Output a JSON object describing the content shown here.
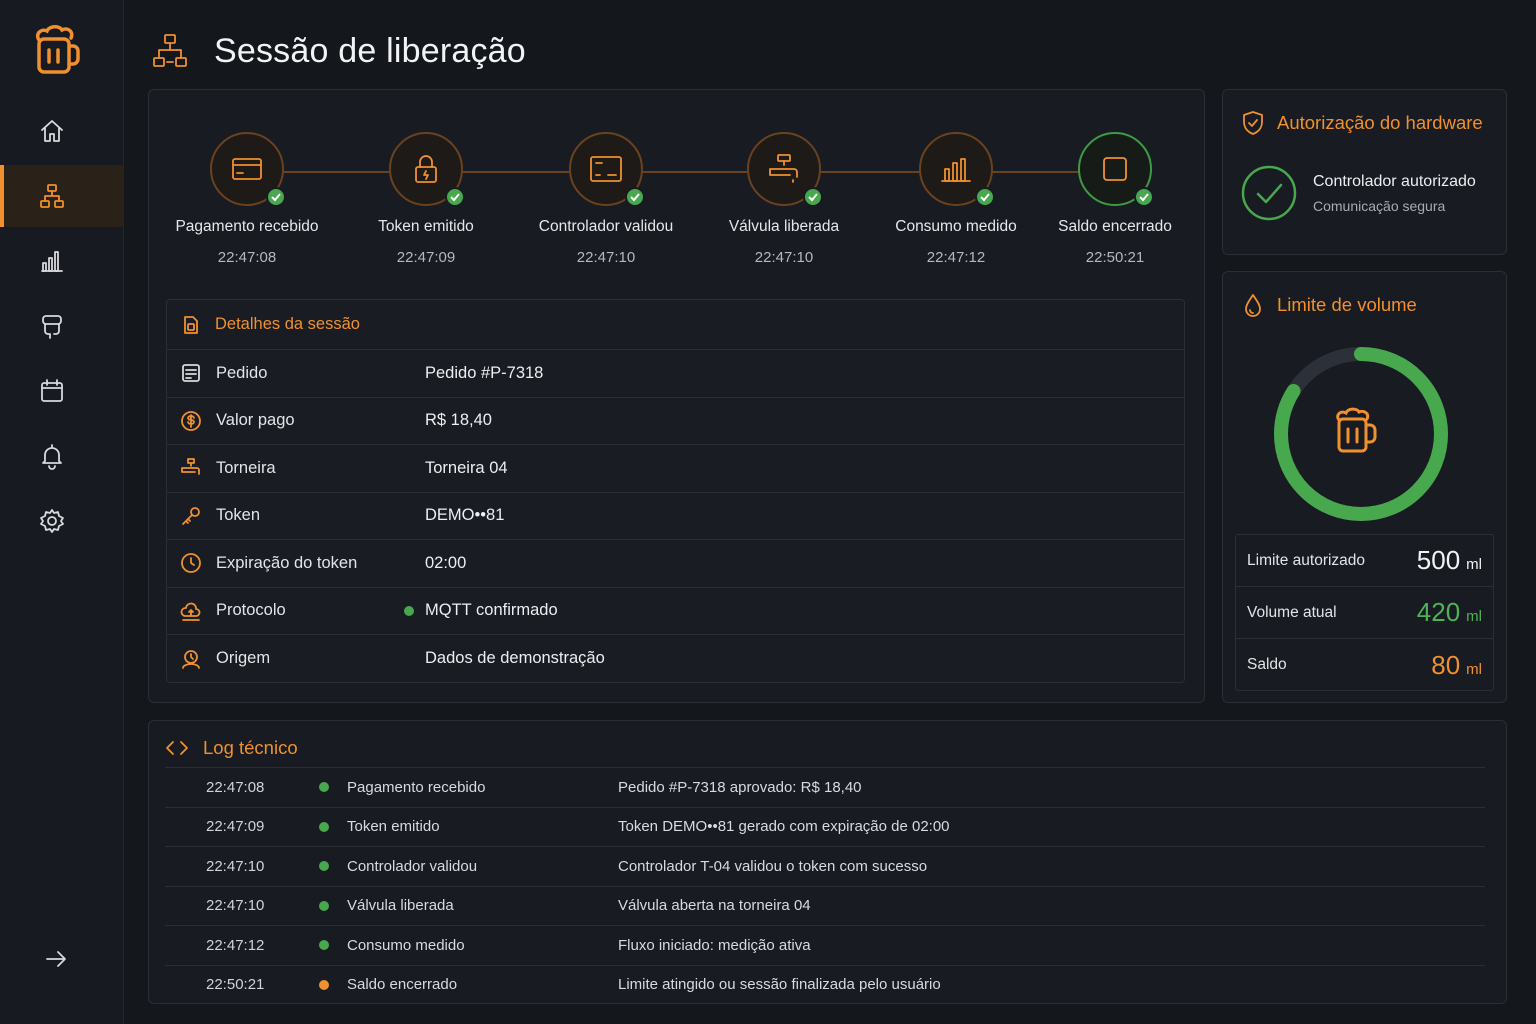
{
  "header": {
    "title": "Sessão de liberação"
  },
  "colors": {
    "accent": "#f0902e",
    "success": "#47a84e",
    "background": "#14171c"
  },
  "sidebar": {
    "items": [
      {
        "icon": "home-icon"
      },
      {
        "icon": "flow-icon",
        "active": true
      },
      {
        "icon": "chart-icon"
      },
      {
        "icon": "tap-icon"
      },
      {
        "icon": "calendar-icon"
      },
      {
        "icon": "bell-icon"
      },
      {
        "icon": "gear-icon"
      }
    ]
  },
  "steps": [
    {
      "label": "Pagamento recebido",
      "time": "22:47:08",
      "icon": "credit-card-icon"
    },
    {
      "label": "Token emitido",
      "time": "22:47:09",
      "icon": "lock-icon"
    },
    {
      "label": "Controlador validou",
      "time": "22:47:10",
      "icon": "controller-icon"
    },
    {
      "label": "Válvula liberada",
      "time": "22:47:10",
      "icon": "valve-icon"
    },
    {
      "label": "Consumo medido",
      "time": "22:47:12",
      "icon": "bar-chart-icon"
    },
    {
      "label": "Saldo encerrado",
      "time": "22:50:21",
      "icon": "square-icon"
    }
  ],
  "details": {
    "title": "Detalhes da sessão",
    "rows": [
      {
        "label": "Pedido",
        "value": "Pedido #P-7318"
      },
      {
        "label": "Valor pago",
        "value": "R$ 18,40"
      },
      {
        "label": "Torneira",
        "value": "Torneira 04"
      },
      {
        "label": "Token",
        "value": "DEMO••81"
      },
      {
        "label": "Expiração do token",
        "value": "02:00"
      },
      {
        "label": "Protocolo",
        "value": "MQTT confirmado"
      },
      {
        "label": "Origem",
        "value": "Dados de demonstração"
      }
    ]
  },
  "auth": {
    "title": "Autorização do hardware",
    "status": "Controlador autorizado",
    "sub": "Comunicação segura"
  },
  "volume": {
    "title": "Limite de volume",
    "fill_fraction": 0.84,
    "rows": [
      {
        "label": "Limite autorizado",
        "value": "500",
        "unit": "ml"
      },
      {
        "label": "Volume atual",
        "value": "420",
        "unit": "ml"
      },
      {
        "label": "Saldo",
        "value": "80",
        "unit": "ml"
      }
    ]
  },
  "log": {
    "title": "Log técnico",
    "rows": [
      {
        "time": "22:47:08",
        "event": "Pagamento recebido",
        "message": "Pedido #P-7318 aprovado: R$ 18,40",
        "status": "success"
      },
      {
        "time": "22:47:09",
        "event": "Token emitido",
        "message": "Token DEMO••81 gerado com expiração de 02:00",
        "status": "success"
      },
      {
        "time": "22:47:10",
        "event": "Controlador validou",
        "message": "Controlador T-04 validou o token com sucesso",
        "status": "success"
      },
      {
        "time": "22:47:10",
        "event": "Válvula liberada",
        "message": "Válvula aberta na torneira 04",
        "status": "success"
      },
      {
        "time": "22:47:12",
        "event": "Consumo medido",
        "message": "Fluxo iniciado: medição ativa",
        "status": "success"
      },
      {
        "time": "22:50:21",
        "event": "Saldo encerrado",
        "message": "Limite atingido ou sessão finalizada pelo usuário",
        "status": "warning"
      }
    ]
  }
}
